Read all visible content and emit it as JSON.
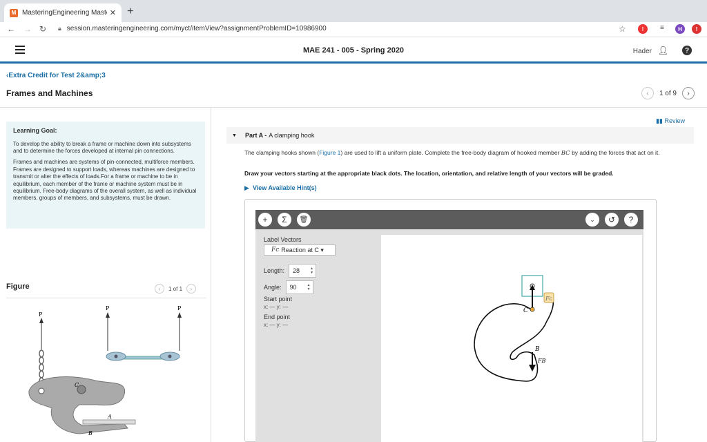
{
  "browser": {
    "tab_title": "MasteringEngineering Masterin",
    "url": "session.masteringengineering.com/myct/itemView?assignmentProblemID=10986900"
  },
  "header": {
    "course": "MAE 241 - 005 - Spring 2020",
    "user": "Hader"
  },
  "breadcrumb": "Extra Credit for Test 2&amp;3",
  "page_title": "Frames and Machines",
  "pager": {
    "text": "1 of 9"
  },
  "learning_goal": {
    "heading": "Learning Goal:",
    "p1": "To develop the ability to break a frame or machine down into subsystems and to determine the forces developed at internal pin connections.",
    "p2": "Frames and machines are systems of pin-connected, multiforce members. Frames are designed to support loads, whereas machines are designed to transmit or alter the effects of loads.For a frame or machine to be in equilibrium, each member of the frame or machine system must be in equilibrium. Free-body diagrams of the overall system, as well as individual members, groups of members, and subsystems, must be drawn."
  },
  "figure": {
    "label": "Figure",
    "pager": "1 of 1",
    "labels": {
      "p": "P",
      "c": "C",
      "a": "A",
      "b": "B"
    }
  },
  "part": {
    "review": "Review",
    "prefix": "Part A -",
    "title": "A clamping hook",
    "desc_before": "The clamping hooks shown (",
    "desc_link": "Figure 1",
    "desc_mid": ") are used to lift a uniform plate. Complete the free-body diagram of hooked member ",
    "desc_var": "BC",
    "desc_after": " by adding the forces that act on it.",
    "instruction": "Draw your vectors starting at the appropriate black dots. The location, orientation, and relative length of your vectors will be graded.",
    "hint": "View Available Hint(s)"
  },
  "tool": {
    "label_vectors": "Label Vectors",
    "selected_vector_symbol": "Fc",
    "selected_vector_text": "Reaction at C",
    "length_label": "Length:",
    "length_value": "28",
    "angle_label": "Angle:",
    "angle_value": "90",
    "start_point": "Start point",
    "start_xy": "x: — y: —",
    "end_point": "End point",
    "end_xy": "x: — y: —",
    "canvas_labels": {
      "c": "C",
      "b": "B",
      "fb": "FB",
      "fc": "Fc"
    }
  }
}
